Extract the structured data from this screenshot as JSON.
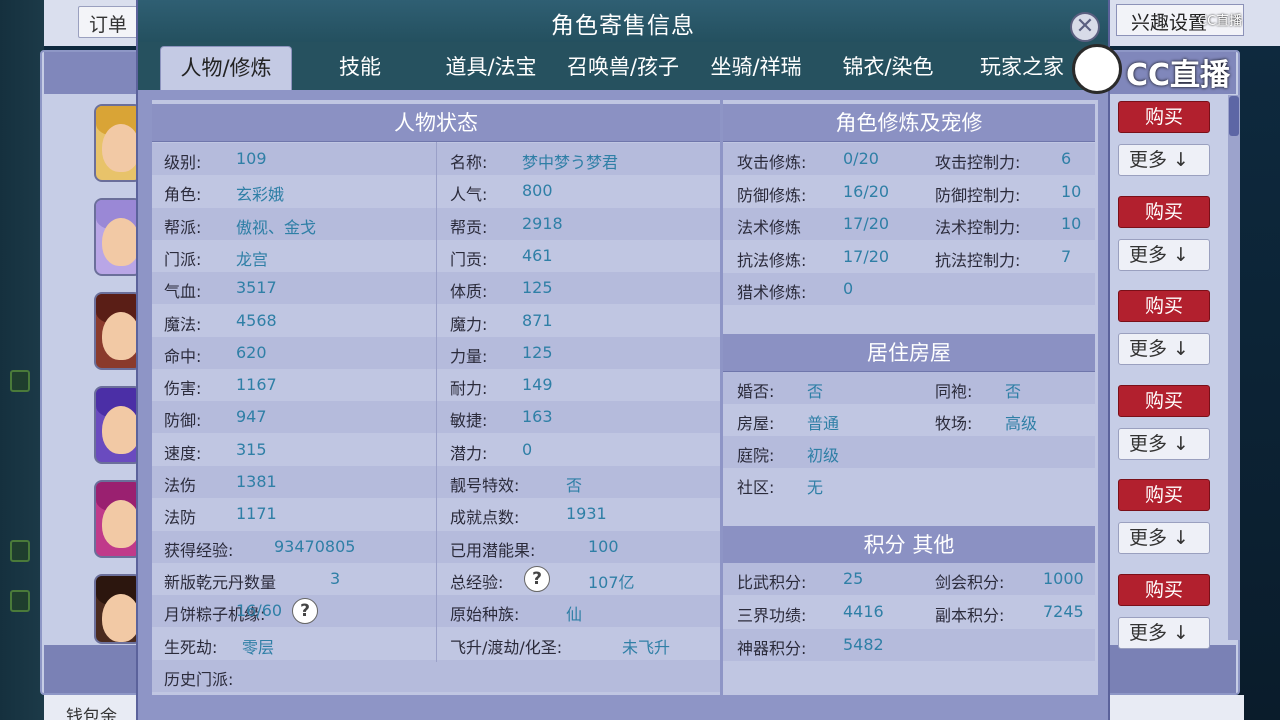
{
  "background": {
    "order_tab": "订单",
    "interest_button": "兴趣设置",
    "wallet_label": "钱包余",
    "buy_label": "购买",
    "more_label": "更多 ↓",
    "rows": 6
  },
  "watermark": {
    "logo_text": "CC直播",
    "small_text": "CC直播"
  },
  "modal": {
    "title": "角色寄售信息",
    "close_symbol": "✕",
    "tabs": [
      "人物/修炼",
      "技能",
      "道具/法宝",
      "召唤兽/孩子",
      "坐骑/祥瑞",
      "锦衣/染色",
      "玩家之家"
    ],
    "active_tab": 0
  },
  "char_status": {
    "header": "人物状态",
    "rows": [
      {
        "l1": "级别:",
        "v1": "109",
        "l2": "名称:",
        "v2": "梦中梦う梦君"
      },
      {
        "l1": "角色:",
        "v1": "玄彩娥",
        "l2": "人气:",
        "v2": "800"
      },
      {
        "l1": "帮派:",
        "v1": "傲视、金戈",
        "l2": "帮贡:",
        "v2": "2918"
      },
      {
        "l1": "门派:",
        "v1": "龙宫",
        "l2": "门贡:",
        "v2": "461"
      },
      {
        "l1": "气血:",
        "v1": "3517",
        "l2": "体质:",
        "v2": "125"
      },
      {
        "l1": "魔法:",
        "v1": "4568",
        "l2": "魔力:",
        "v2": "871"
      },
      {
        "l1": "命中:",
        "v1": "620",
        "l2": "力量:",
        "v2": "125"
      },
      {
        "l1": "伤害:",
        "v1": "1167",
        "l2": "耐力:",
        "v2": "149"
      },
      {
        "l1": "防御:",
        "v1": "947",
        "l2": "敏捷:",
        "v2": "163"
      },
      {
        "l1": "速度:",
        "v1": "315",
        "l2": "潜力:",
        "v2": "0"
      },
      {
        "l1": "法伤",
        "v1": "1381",
        "l2": "靓号特效:",
        "v2": "否"
      },
      {
        "l1": "法防",
        "v1": "1171",
        "l2": "成就点数:",
        "v2": "1931"
      },
      {
        "l1": "获得经验:",
        "v1": "93470805",
        "l2": "已用潜能果:",
        "v2": "100"
      },
      {
        "l1": "新版乾元丹数量",
        "v1": "3",
        "l2": "总经验:",
        "v2": "107亿"
      },
      {
        "l1": "月饼粽子机缘:",
        "v1": "16/60",
        "l2": "原始种族:",
        "v2": "仙"
      },
      {
        "l1": "生死劫:",
        "v1": "零层",
        "l2": "飞升/渡劫/化圣:",
        "v2": "未飞升"
      },
      {
        "l1": "历史门派:",
        "v1": "",
        "l2": "",
        "v2": ""
      }
    ]
  },
  "cultivation": {
    "header": "角色修炼及宠修",
    "rows": [
      {
        "l1": "攻击修炼:",
        "v1": "0/20",
        "l2": "攻击控制力:",
        "v2": "6"
      },
      {
        "l1": "防御修炼:",
        "v1": "16/20",
        "l2": "防御控制力:",
        "v2": "10"
      },
      {
        "l1": "法术修炼",
        "v1": "17/20",
        "l2": "法术控制力:",
        "v2": "10"
      },
      {
        "l1": "抗法修炼:",
        "v1": "17/20",
        "l2": "抗法控制力:",
        "v2": "7"
      },
      {
        "l1": "猎术修炼:",
        "v1": "0",
        "l2": "",
        "v2": ""
      }
    ]
  },
  "housing": {
    "header": "居住房屋",
    "rows": [
      {
        "l1": "婚否:",
        "v1": "否",
        "l2": "同袍:",
        "v2": "否"
      },
      {
        "l1": "房屋:",
        "v1": "普通",
        "l2": "牧场:",
        "v2": "高级"
      },
      {
        "l1": "庭院:",
        "v1": "初级",
        "l2": "",
        "v2": ""
      },
      {
        "l1": "社区:",
        "v1": "无",
        "l2": "",
        "v2": ""
      }
    ]
  },
  "points": {
    "header": "积分 其他",
    "rows": [
      {
        "l1": "比武积分:",
        "v1": "25",
        "l2": "剑会积分:",
        "v2": "1000"
      },
      {
        "l1": "三界功绩:",
        "v1": "4416",
        "l2": "副本积分:",
        "v2": "7245"
      },
      {
        "l1": "神器积分:",
        "v1": "5482",
        "l2": "",
        "v2": ""
      }
    ]
  },
  "colors": {
    "buy": "#b2202e",
    "title_bar": "#2f5f73",
    "value_text": "#2f7fa6"
  },
  "help_symbol": "?"
}
